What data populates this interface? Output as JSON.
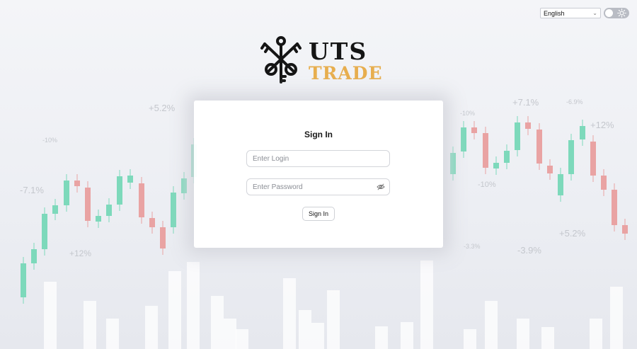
{
  "language_selector": {
    "selected": "English"
  },
  "theme_toggle": {
    "icon": "sun-icon",
    "state": "light"
  },
  "logo": {
    "line1": "UTS",
    "line2": "TRADE",
    "icon": "crossed-keys-icon"
  },
  "login_card": {
    "title": "Sign In",
    "login_placeholder": "Enter Login",
    "password_placeholder": "Enter Password",
    "password_toggle_icon": "eye-slash-icon",
    "submit_label": "Sign In"
  },
  "background": {
    "labels": [
      "+5.2%",
      "-10%",
      "-7.1%",
      "+12%",
      "+7.1%",
      "-6.9%",
      "-10%",
      "+12%",
      "-10%",
      "+5.2%",
      "-3.9%",
      "-3.3%"
    ]
  },
  "colors": {
    "up": "#7dd9bb",
    "down": "#e9a3a3",
    "brand_gold": "#e7ae4e",
    "brand_dark": "#151515"
  }
}
